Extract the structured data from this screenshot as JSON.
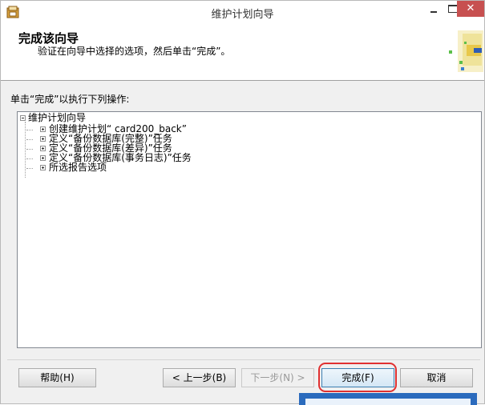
{
  "window": {
    "title": "维护计划向导",
    "close_glyph": "✕"
  },
  "header": {
    "title": "完成该向导",
    "subtitle": "验证在向导中选择的选项，然后单击“完成”。"
  },
  "instruction": "单击“完成”以执行下列操作:",
  "tree": {
    "root": "维护计划向导",
    "children": [
      "创建维护计划“ card200_back”",
      "定义“备份数据库(完整)”任务",
      "定义“备份数据库(差异)”任务",
      "定义“备份数据库(事务日志)”任务",
      "所选报告选项"
    ]
  },
  "buttons": {
    "help": "帮助(H)",
    "back": "< 上一步(B)",
    "next": "下一步(N) >",
    "finish": "完成(F)",
    "cancel": "取消"
  },
  "colors": {
    "close_button": "#c75050",
    "highlight_ring": "#e03030",
    "popup": "#2b6bbd"
  }
}
